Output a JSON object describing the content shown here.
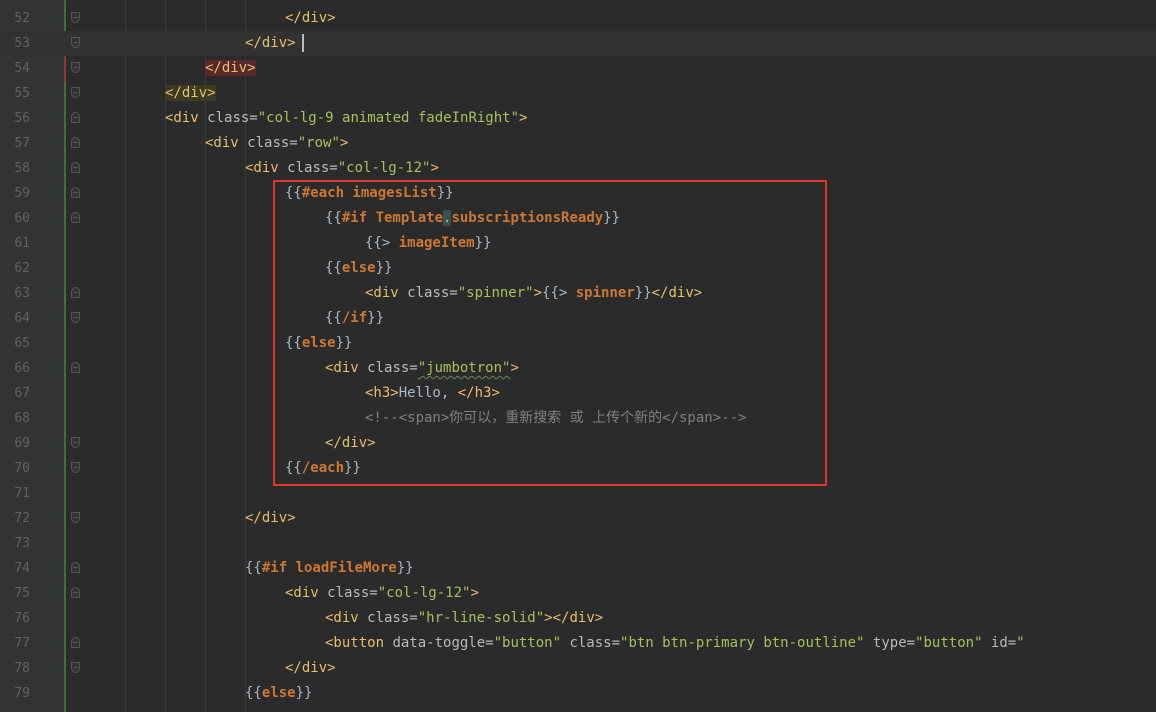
{
  "editor": {
    "colors": {
      "background": "#2b2b2b",
      "gutter": "#313335",
      "tag": "#e8bf6a",
      "attribute": "#bababa",
      "string": "#a5c25c",
      "keyword": "#cc7832",
      "comment": "#808080",
      "highlight_box": "#e0342c"
    },
    "lines": [
      {
        "num": "52",
        "parts": [
          {
            "t": "</div>",
            "c": "tag"
          }
        ]
      },
      {
        "num": "53",
        "parts": [
          {
            "t": "</div",
            "c": "tag"
          },
          {
            "t": ">",
            "c": "tag"
          }
        ]
      },
      {
        "num": "54",
        "parts": [
          {
            "t": "</div>",
            "c": "tag"
          }
        ]
      },
      {
        "num": "55",
        "parts": [
          {
            "t": "</div>",
            "c": "tag"
          }
        ]
      },
      {
        "num": "56",
        "parts": [
          {
            "t": "<div ",
            "c": "tag"
          },
          {
            "t": "class=",
            "c": "attr"
          },
          {
            "t": "\"col-lg-9 animated fadeInRight\"",
            "c": "str"
          },
          {
            "t": ">",
            "c": "tag"
          }
        ]
      },
      {
        "num": "57",
        "parts": [
          {
            "t": "<div ",
            "c": "tag"
          },
          {
            "t": "class=",
            "c": "attr"
          },
          {
            "t": "\"row\"",
            "c": "str"
          },
          {
            "t": ">",
            "c": "tag"
          }
        ]
      },
      {
        "num": "58",
        "parts": [
          {
            "t": "<div ",
            "c": "tag"
          },
          {
            "t": "class=",
            "c": "attr"
          },
          {
            "t": "\"col-lg-12\"",
            "c": "str"
          },
          {
            "t": ">",
            "c": "tag"
          }
        ]
      },
      {
        "num": "59",
        "parts": [
          {
            "t": "{{",
            "c": "brace"
          },
          {
            "t": "#each imagesList",
            "c": "kw"
          },
          {
            "t": "}}",
            "c": "brace"
          }
        ]
      },
      {
        "num": "60",
        "parts": [
          {
            "t": "{{",
            "c": "brace"
          },
          {
            "t": "#if Template",
            "c": "kw"
          },
          {
            "t": ".",
            "c": "brace"
          },
          {
            "t": "subscriptionsReady",
            "c": "kw"
          },
          {
            "t": "}}",
            "c": "brace"
          }
        ]
      },
      {
        "num": "61",
        "parts": [
          {
            "t": "{{> ",
            "c": "brace"
          },
          {
            "t": "imageItem",
            "c": "kw"
          },
          {
            "t": "}}",
            "c": "brace"
          }
        ]
      },
      {
        "num": "62",
        "parts": [
          {
            "t": "{{",
            "c": "brace"
          },
          {
            "t": "else",
            "c": "kw"
          },
          {
            "t": "}}",
            "c": "brace"
          }
        ]
      },
      {
        "num": "63",
        "parts": [
          {
            "t": "<div ",
            "c": "tag"
          },
          {
            "t": "class=",
            "c": "attr"
          },
          {
            "t": "\"spinner\"",
            "c": "str"
          },
          {
            "t": ">",
            "c": "tag"
          },
          {
            "t": "{{> ",
            "c": "brace"
          },
          {
            "t": "spinner",
            "c": "kw"
          },
          {
            "t": "}}",
            "c": "brace"
          },
          {
            "t": "</div>",
            "c": "tag"
          }
        ]
      },
      {
        "num": "64",
        "parts": [
          {
            "t": "{{",
            "c": "brace"
          },
          {
            "t": "/if",
            "c": "kw"
          },
          {
            "t": "}}",
            "c": "brace"
          }
        ]
      },
      {
        "num": "65",
        "parts": [
          {
            "t": "{{",
            "c": "brace"
          },
          {
            "t": "else",
            "c": "kw"
          },
          {
            "t": "}}",
            "c": "brace"
          }
        ]
      },
      {
        "num": "66",
        "parts": [
          {
            "t": "<div ",
            "c": "tag"
          },
          {
            "t": "class=",
            "c": "attr"
          },
          {
            "t": "\"jumbotron\"",
            "c": "str"
          },
          {
            "t": ">",
            "c": "tag"
          }
        ]
      },
      {
        "num": "67",
        "parts": [
          {
            "t": "<h3>",
            "c": "tag"
          },
          {
            "t": "Hello, ",
            "c": "brace"
          },
          {
            "t": "</h3>",
            "c": "tag"
          }
        ]
      },
      {
        "num": "68",
        "parts": [
          {
            "t": "<!--<span>你可以，重新搜索 或 上传个新的</span>-->",
            "c": "comment"
          }
        ]
      },
      {
        "num": "69",
        "parts": [
          {
            "t": "</div>",
            "c": "tag"
          }
        ]
      },
      {
        "num": "70",
        "parts": [
          {
            "t": "{{",
            "c": "brace"
          },
          {
            "t": "/each",
            "c": "kw"
          },
          {
            "t": "}}",
            "c": "brace"
          }
        ]
      },
      {
        "num": "71",
        "parts": []
      },
      {
        "num": "72",
        "parts": [
          {
            "t": "</div>",
            "c": "tag"
          }
        ]
      },
      {
        "num": "73",
        "parts": []
      },
      {
        "num": "74",
        "parts": [
          {
            "t": "{{",
            "c": "brace"
          },
          {
            "t": "#if loadFileMore",
            "c": "kw"
          },
          {
            "t": "}}",
            "c": "brace"
          }
        ]
      },
      {
        "num": "75",
        "parts": [
          {
            "t": "<div ",
            "c": "tag"
          },
          {
            "t": "class=",
            "c": "attr"
          },
          {
            "t": "\"col-lg-12\"",
            "c": "str"
          },
          {
            "t": ">",
            "c": "tag"
          }
        ]
      },
      {
        "num": "76",
        "parts": [
          {
            "t": "<div ",
            "c": "tag"
          },
          {
            "t": "class=",
            "c": "attr"
          },
          {
            "t": "\"hr-line-solid\"",
            "c": "str"
          },
          {
            "t": "></div>",
            "c": "tag"
          }
        ]
      },
      {
        "num": "77",
        "parts": [
          {
            "t": "<button ",
            "c": "tag"
          },
          {
            "t": "data-toggle=",
            "c": "attr"
          },
          {
            "t": "\"button\" ",
            "c": "str"
          },
          {
            "t": "class=",
            "c": "attr"
          },
          {
            "t": "\"btn btn-primary btn-outline\" ",
            "c": "str"
          },
          {
            "t": "type=",
            "c": "attr"
          },
          {
            "t": "\"button\" ",
            "c": "str"
          },
          {
            "t": "id=",
            "c": "attr"
          },
          {
            "t": "\"",
            "c": "str"
          }
        ]
      },
      {
        "num": "78",
        "parts": [
          {
            "t": "</div>",
            "c": "tag"
          }
        ]
      },
      {
        "num": "79",
        "parts": [
          {
            "t": "{{",
            "c": "brace"
          },
          {
            "t": "else",
            "c": "kw"
          },
          {
            "t": "}}",
            "c": "brace"
          }
        ]
      }
    ]
  }
}
